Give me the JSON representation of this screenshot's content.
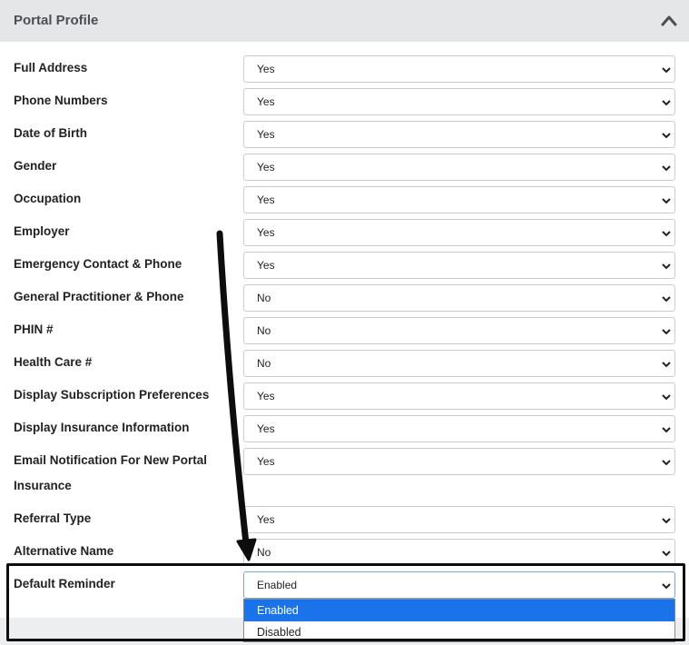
{
  "header": {
    "title": "Portal Profile",
    "collapse_icon": "chevron-up-icon"
  },
  "rows": [
    {
      "key": "full-address",
      "label": "Full Address",
      "value": "Yes"
    },
    {
      "key": "phone-numbers",
      "label": "Phone Numbers",
      "value": "Yes"
    },
    {
      "key": "date-of-birth",
      "label": "Date of Birth",
      "value": "Yes"
    },
    {
      "key": "gender",
      "label": "Gender",
      "value": "Yes"
    },
    {
      "key": "occupation",
      "label": "Occupation",
      "value": "Yes"
    },
    {
      "key": "employer",
      "label": "Employer",
      "value": "Yes"
    },
    {
      "key": "emergency-contact",
      "label": "Emergency Contact & Phone",
      "value": "Yes"
    },
    {
      "key": "general-practitioner",
      "label": "General Practitioner & Phone",
      "value": "No"
    },
    {
      "key": "phin",
      "label": "PHIN #",
      "value": "No"
    },
    {
      "key": "health-care",
      "label": "Health Care #",
      "value": "No"
    },
    {
      "key": "subscription-prefs",
      "label": "Display Subscription Preferences",
      "value": "Yes"
    },
    {
      "key": "insurance-info",
      "label": "Display Insurance Information",
      "value": "Yes"
    },
    {
      "key": "email-notification",
      "label_line1": "Email Notification For New Portal",
      "label_line2": "Insurance",
      "value": "Yes"
    },
    {
      "key": "referral-type",
      "label": "Referral Type",
      "value": "Yes"
    },
    {
      "key": "alternative-name",
      "label": "Alternative Name",
      "value": "No"
    },
    {
      "key": "default-reminder",
      "label": "Default Reminder",
      "value": "Enabled"
    }
  ],
  "reminder_dropdown": {
    "options": [
      "Enabled",
      "Disabled"
    ],
    "selected": "Enabled"
  },
  "colors": {
    "header_bg": "#e4e6e8",
    "selected_option": "#1a73e8",
    "highlight_border": "#0d0d0d"
  }
}
